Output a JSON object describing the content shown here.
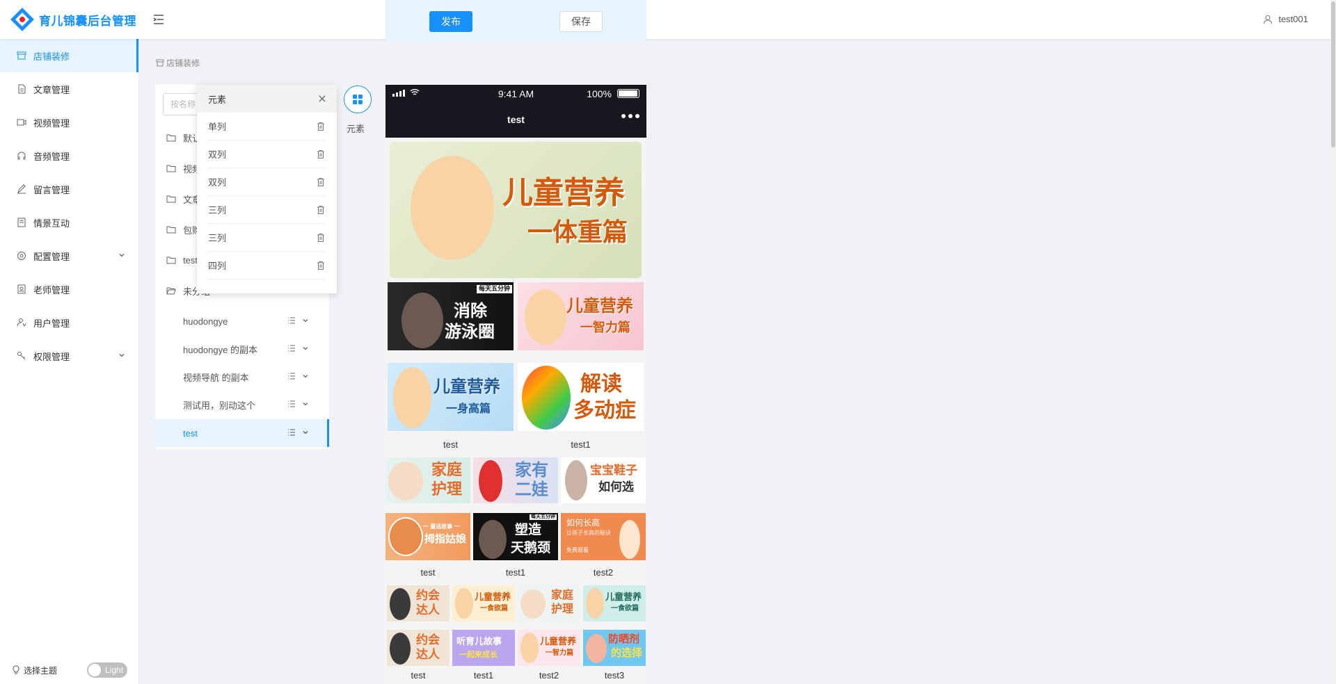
{
  "app": {
    "title": "育儿锦囊后台管理"
  },
  "header": {
    "username": "test001"
  },
  "publish_bar": {
    "publish_label": "发布",
    "save_label": "保存"
  },
  "sidebar": {
    "items": [
      {
        "label": "店铺装修",
        "icon": "shop-icon"
      },
      {
        "label": "文章管理",
        "icon": "document-icon"
      },
      {
        "label": "视频管理",
        "icon": "video-icon"
      },
      {
        "label": "音频管理",
        "icon": "headphones-icon"
      },
      {
        "label": "留言管理",
        "icon": "edit-icon"
      },
      {
        "label": "情景互动",
        "icon": "book-icon"
      },
      {
        "label": "配置管理",
        "icon": "settings-icon"
      },
      {
        "label": "老师管理",
        "icon": "contacts-icon"
      },
      {
        "label": "用户管理",
        "icon": "user-icon"
      },
      {
        "label": "权限管理",
        "icon": "key-icon"
      }
    ],
    "theme_label": "选择主题",
    "theme_toggle": "Light"
  },
  "breadcrumb": {
    "current": "店铺装修"
  },
  "tree": {
    "search_placeholder": "按名称",
    "folders": [
      "默认",
      "视频",
      "文章",
      "包购",
      "test",
      "未分组"
    ],
    "leaves": [
      "huodongye",
      "huodongye 的副本",
      "视频导航 的副本",
      "测试用，别动这个",
      "test"
    ]
  },
  "elements_popup": {
    "title": "元素",
    "rows": [
      "单列",
      "双列",
      "双列",
      "三列",
      "三列",
      "四列"
    ]
  },
  "element_button": {
    "label": "元素"
  },
  "phone": {
    "status_time": "9:41 AM",
    "status_battery": "100%",
    "nav_title": "test",
    "banner": {
      "line1": "儿童营养",
      "line2": "一体重篇"
    },
    "two_col_row1": [
      {
        "text1": "消除",
        "text2": "游泳圈",
        "tag": "每天五分钟"
      },
      {
        "text1": "儿童营养",
        "text2": "一智力篇"
      }
    ],
    "two_col_row2": [
      {
        "text1": "儿童营养",
        "text2": "一身高篇"
      },
      {
        "text1": "解读",
        "text2": "多动症"
      }
    ],
    "two_col_captions": [
      "test",
      "test1"
    ],
    "three_col_row1": [
      {
        "text1": "家庭",
        "text2": "护理"
      },
      {
        "text1": "家有",
        "text2": "二娃"
      },
      {
        "text1": "宝宝鞋子",
        "text2": "如何选"
      }
    ],
    "three_col_row2": [
      {
        "text1": "拇指姑娘",
        "text2": "一 童话故事 一"
      },
      {
        "text1": "塑造",
        "text2": "天鹅颈",
        "tag": "每天五分钟"
      },
      {
        "text1": "如何长高",
        "text2": "让孩子长高的秘诀",
        "tag": "免费观看"
      }
    ],
    "three_col_captions": [
      "test",
      "test1",
      "test2"
    ],
    "four_col_row1": [
      {
        "text1": "约会",
        "text2": "达人"
      },
      {
        "text1": "儿童营养",
        "text2": "一食欲篇"
      },
      {
        "text1": "家庭",
        "text2": "护理"
      },
      {
        "text1": "儿童营养",
        "text2": "一食欲篇"
      }
    ],
    "four_col_row2": [
      {
        "text1": "约会",
        "text2": "达人"
      },
      {
        "text1": "听育儿故事",
        "text2": "一起来成长"
      },
      {
        "text1": "儿童营养",
        "text2": "一智力篇"
      },
      {
        "text1": "防晒剂",
        "text2": "的选择"
      }
    ],
    "four_col_captions": [
      "test",
      "test1",
      "test2",
      "test3"
    ]
  },
  "colors": {
    "accent": "#1890ff",
    "dark_bar": "#18161e"
  }
}
